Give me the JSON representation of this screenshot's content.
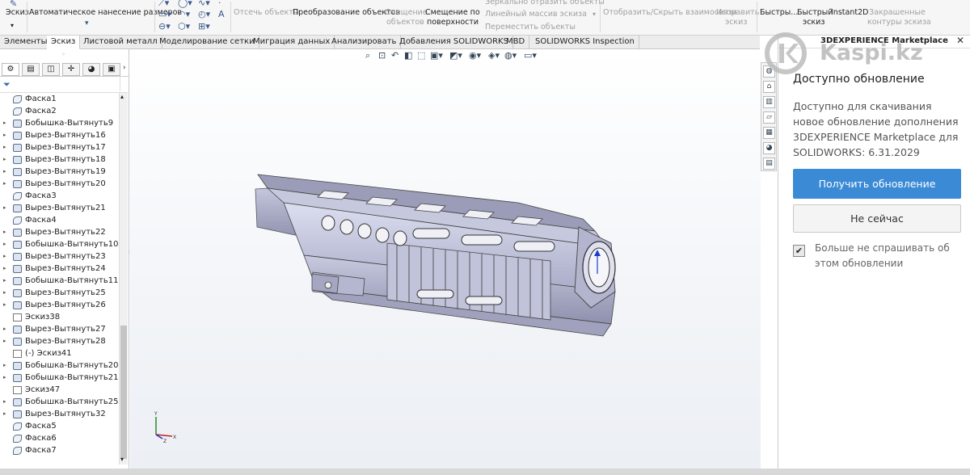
{
  "ribbon": {
    "sketch_label": "Эскиз",
    "auto_dim_label": "Автоматическое нанесение размеров",
    "trim_label": "Отсечь объекты",
    "convert_label": "Преобразование объектов",
    "offset_label_1": "Смещение",
    "offset_label_2": "объектов",
    "offset_surface_1": "Смещение по",
    "offset_surface_2": "поверхности",
    "mirror_label": "Зеркально отразить объекты",
    "linear_pattern_label": "Линейный массив эскиза",
    "move_label": "Переместить объекты",
    "show_relations_label": "Отобразить/Скрыть взаимосвязи",
    "repair_label_1": "Исправить",
    "repair_label_2": "эскиз",
    "quick_label": "Быстры...",
    "rapid_sketch_1": "Быстрый",
    "rapid_sketch_2": "эскиз",
    "instant2d_label": "Instant2D",
    "shaded_contours_1": "Закрашенные",
    "shaded_contours_2": "контуры эскиза"
  },
  "tabs": [
    "Элементы",
    "Эскиз",
    "Листовой металл",
    "Моделирование сетки",
    "Миграция данных",
    "Анализировать",
    "Добавления SOLIDWORKS",
    "MBD",
    "SOLIDWORKS Inspection"
  ],
  "tree": [
    {
      "label": "Фаска1",
      "type": "chamfer",
      "exp": false
    },
    {
      "label": "Фаска2",
      "type": "chamfer",
      "exp": false
    },
    {
      "label": "Бобышка-Вытянуть9",
      "type": "feature",
      "exp": true
    },
    {
      "label": "Вырез-Вытянуть16",
      "type": "feature",
      "exp": true
    },
    {
      "label": "Вырез-Вытянуть17",
      "type": "feature",
      "exp": true
    },
    {
      "label": "Вырез-Вытянуть18",
      "type": "feature",
      "exp": true
    },
    {
      "label": "Вырез-Вытянуть19",
      "type": "feature",
      "exp": true
    },
    {
      "label": "Вырез-Вытянуть20",
      "type": "feature",
      "exp": true
    },
    {
      "label": "Фаска3",
      "type": "chamfer",
      "exp": false
    },
    {
      "label": "Вырез-Вытянуть21",
      "type": "feature",
      "exp": true
    },
    {
      "label": "Фаска4",
      "type": "chamfer",
      "exp": false
    },
    {
      "label": "Вырез-Вытянуть22",
      "type": "feature",
      "exp": true
    },
    {
      "label": "Бобышка-Вытянуть10",
      "type": "feature",
      "exp": true
    },
    {
      "label": "Вырез-Вытянуть23",
      "type": "feature",
      "exp": true
    },
    {
      "label": "Вырез-Вытянуть24",
      "type": "feature",
      "exp": true
    },
    {
      "label": "Бобышка-Вытянуть11",
      "type": "feature",
      "exp": true
    },
    {
      "label": "Вырез-Вытянуть25",
      "type": "feature",
      "exp": true
    },
    {
      "label": "Вырез-Вытянуть26",
      "type": "feature",
      "exp": true
    },
    {
      "label": "Эскиз38",
      "type": "sketch",
      "exp": false
    },
    {
      "label": "Вырез-Вытянуть27",
      "type": "feature",
      "exp": true
    },
    {
      "label": "Вырез-Вытянуть28",
      "type": "feature",
      "exp": true
    },
    {
      "label": "(-) Эскиз41",
      "type": "sketch",
      "exp": false
    },
    {
      "label": "Бобышка-Вытянуть20",
      "type": "feature",
      "exp": true
    },
    {
      "label": "Бобышка-Вытянуть21",
      "type": "feature",
      "exp": true
    },
    {
      "label": "Эскиз47",
      "type": "sketch",
      "exp": false
    },
    {
      "label": "Бобышка-Вытянуть25",
      "type": "feature",
      "exp": true
    },
    {
      "label": "Вырез-Вытянуть32",
      "type": "feature",
      "exp": true
    },
    {
      "label": "Фаска5",
      "type": "chamfer",
      "exp": false
    },
    {
      "label": "Фаска6",
      "type": "chamfer",
      "exp": false
    },
    {
      "label": "Фаска7",
      "type": "chamfer",
      "exp": false
    }
  ],
  "panel": {
    "header": "3DEXPERIENCE Marketplace",
    "close": "✕",
    "title": "Доступно обновление",
    "description": "Доступно для скачивания новое обновление дополнения 3DEXPERIENCE Marketplace для SOLIDWORKS: 6.31.2029",
    "primary_button": "Получить обновление",
    "secondary_button": "Не сейчас",
    "checkbox_checked": true,
    "checkbox_label": "Больше не спрашивать об этом обновлении"
  },
  "watermark": "Kaspi.kz",
  "triad": {
    "y": "Y",
    "x": "X",
    "z": "Z"
  },
  "colors": {
    "accent": "#3b8ad6",
    "model": "#c9cbe2",
    "model_dark": "#8a8ca8"
  }
}
